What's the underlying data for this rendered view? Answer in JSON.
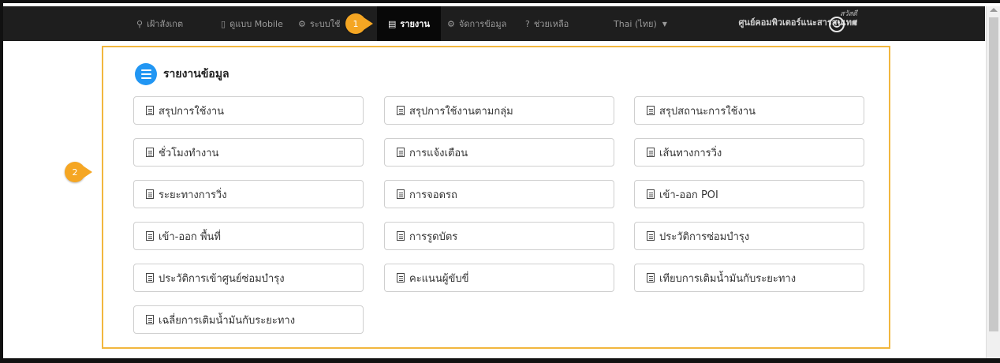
{
  "navbar": {
    "items": [
      {
        "icon": "map-marker-icon",
        "glyph": "⚲",
        "label": "เฝ้าสังเกต"
      },
      {
        "icon": "mobile-icon",
        "glyph": "▯",
        "label": "ดูแบบ Mobile"
      },
      {
        "icon": "cogs-icon",
        "glyph": "⚙",
        "label": "ระบบใช้"
      },
      {
        "icon": "file-icon",
        "glyph": "▤",
        "label": "รายงาน"
      },
      {
        "icon": "gear-icon",
        "glyph": "⚙",
        "label": "จัดการข้อมูล"
      },
      {
        "icon": "question-icon",
        "glyph": "?",
        "label": "ช่วยเหลือ"
      }
    ],
    "language": "Thai (ไทย)",
    "greeting": "สวัสดี",
    "user_name": "ศูนย์คอมพิวเตอร์แนะสารสนเทศ"
  },
  "badges": [
    "1",
    "2"
  ],
  "panel": {
    "title": "รายงานข้อมูล",
    "reports": [
      "สรุปการใช้งาน",
      "สรุปการใช้งานตามกลุ่ม",
      "สรุปสถานะการใช้งาน",
      "ชั่วโมงทำงาน",
      "การแจ้งเตือน",
      "เส้นทางการวิ่ง",
      "ระยะทางการวิ่ง",
      "การจอดรถ",
      "เข้า-ออก POI",
      "เข้า-ออก พื้นที่",
      "การรูดบัตร",
      "ประวัติการซ่อมบำรุง",
      "ประวัติการเข้าศูนย์ซ่อมบำรุง",
      "คะแนนผู้ขับขี่",
      "เทียบการเติมน้ำมันกับระยะทาง",
      "เฉลี่ยการเติมน้ำมันกับระยะทาง"
    ]
  },
  "colors": {
    "accent": "#f2b73e",
    "badge": "#f5a623",
    "icon_blue": "#2196f3",
    "navbar": "#1e1e1e"
  }
}
